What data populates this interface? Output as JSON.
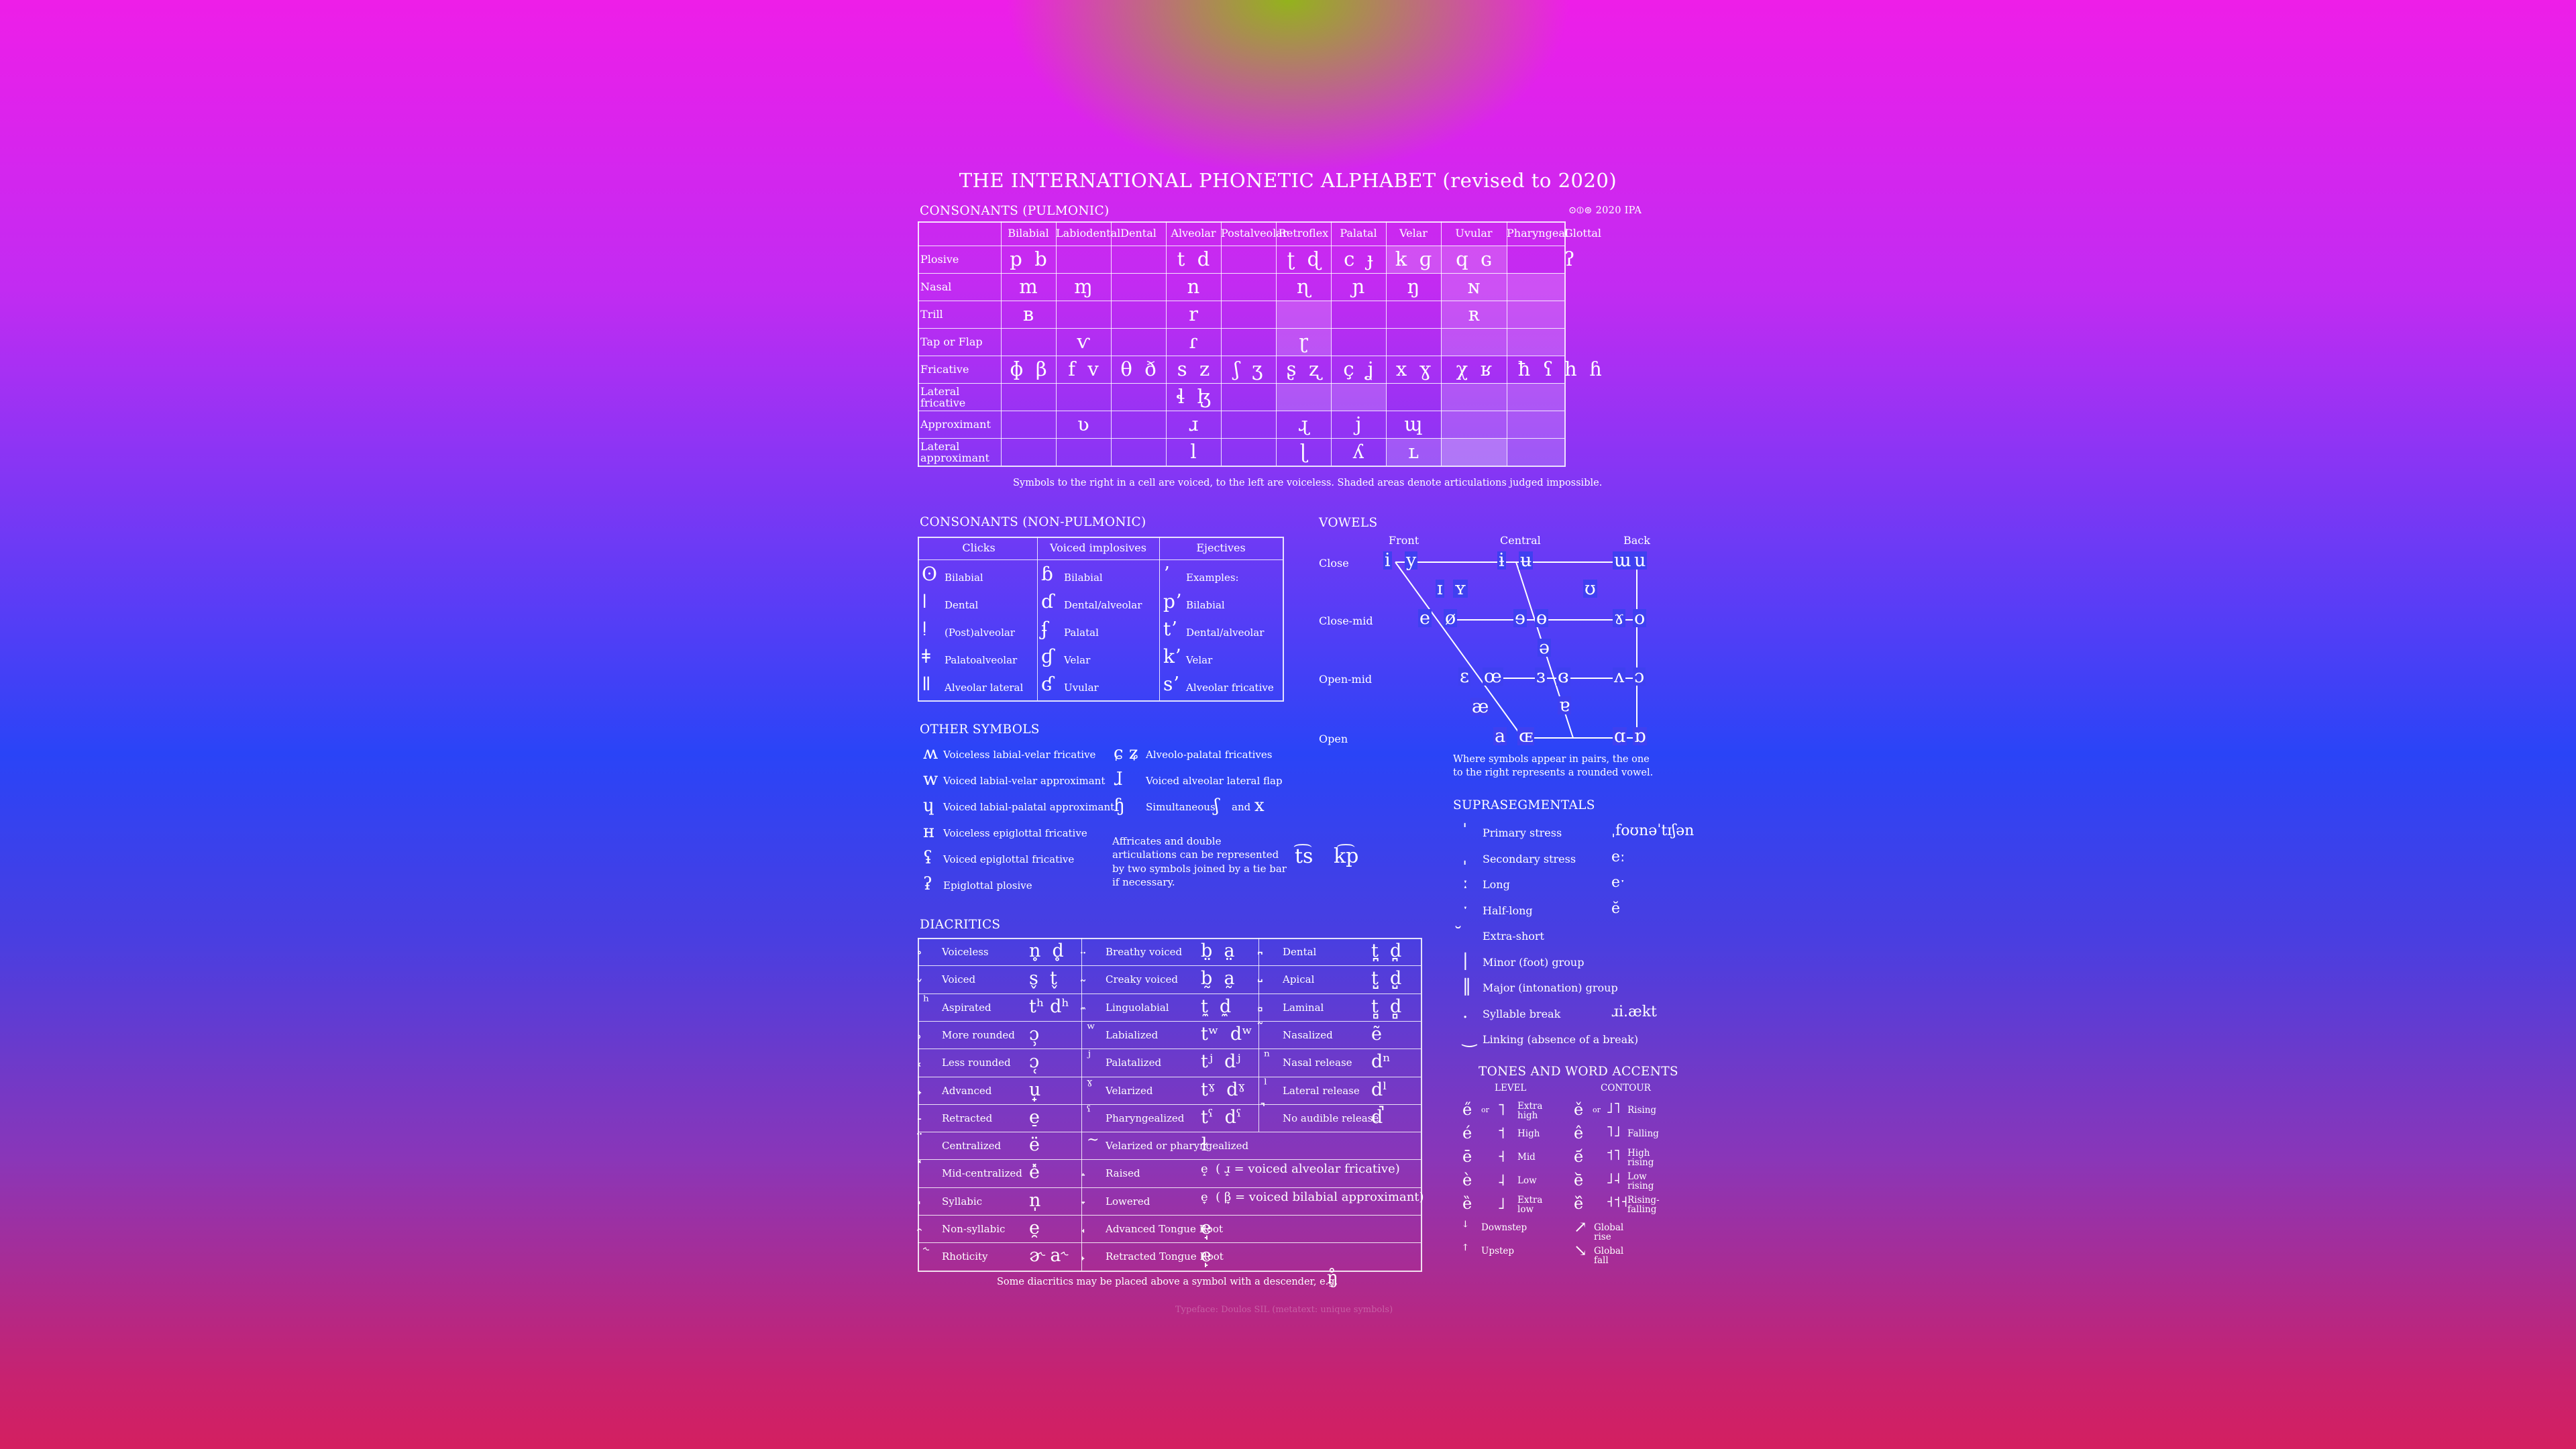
{
  "title": "THE INTERNATIONAL PHONETIC ALPHABET (revised to 2020)",
  "pulmonic": {
    "heading": "CONSONANTS (PULMONIC)",
    "copyright": "⊙⦶⊚ 2020 IPA",
    "columns": [
      "Bilabial",
      "Labiodental",
      "Dental",
      "Alveolar",
      "Postalveolar",
      "Retroflex",
      "Palatal",
      "Velar",
      "Uvular",
      "Pharyngeal",
      "Glottal"
    ],
    "rows": [
      {
        "label": "Plosive",
        "cells": [
          "p  b",
          "",
          "",
          "t  d",
          "",
          "ʈ  ɖ",
          "c  ɟ",
          "k  ɡ",
          "q  ɢ",
          "",
          "ʔ"
        ]
      },
      {
        "label": "Nasal",
        "cells": [
          "m",
          "ɱ",
          "",
          "n",
          "",
          "ɳ",
          "ɲ",
          "ŋ",
          "ɴ",
          "",
          ""
        ]
      },
      {
        "label": "Trill",
        "cells": [
          "ʙ",
          "",
          "",
          "r",
          "",
          "",
          "",
          "",
          "ʀ",
          "",
          ""
        ]
      },
      {
        "label": "Tap or Flap",
        "cells": [
          "",
          "ⱱ",
          "",
          "ɾ",
          "",
          "ɽ",
          "",
          "",
          "",
          "",
          ""
        ]
      },
      {
        "label": "Fricative",
        "cells": [
          "ɸ  β",
          "f  v",
          "θ  ð",
          "s  z",
          "ʃ  ʒ",
          "ʂ  ʐ",
          "ç  ʝ",
          "x  ɣ",
          "χ  ʁ",
          "ħ  ʕ",
          "h  ɦ"
        ]
      },
      {
        "label": "Lateral fricative",
        "cells": [
          "",
          "",
          "",
          "ɬ  ɮ",
          "",
          "",
          "",
          "",
          "",
          "",
          ""
        ]
      },
      {
        "label": "Approximant",
        "cells": [
          "",
          "ʋ",
          "",
          "ɹ",
          "",
          "ɻ",
          "j",
          "ɰ",
          "",
          "",
          ""
        ]
      },
      {
        "label": "Lateral approximant",
        "cells": [
          "",
          "",
          "",
          "l",
          "",
          "ɭ",
          "ʎ",
          "ʟ",
          "",
          "",
          ""
        ]
      }
    ],
    "note": "Symbols to the right in a cell are voiced, to the left are voiceless. Shaded areas denote articulations judged impossible."
  },
  "nonpulmonic": {
    "heading": "CONSONANTS (NON-PULMONIC)",
    "columns": [
      "Clicks",
      "Voiced implosives",
      "Ejectives"
    ],
    "clicks": [
      [
        "ʘ",
        "Bilabial"
      ],
      [
        "ǀ",
        "Dental"
      ],
      [
        "ǃ",
        "(Post)alveolar"
      ],
      [
        "ǂ",
        "Palatoalveolar"
      ],
      [
        "ǁ",
        "Alveolar lateral"
      ]
    ],
    "implosives": [
      [
        "ɓ",
        "Bilabial"
      ],
      [
        "ɗ",
        "Dental/alveolar"
      ],
      [
        "ʄ",
        "Palatal"
      ],
      [
        "ɠ",
        "Velar"
      ],
      [
        "ʛ",
        "Uvular"
      ]
    ],
    "ejectives": [
      [
        "ʼ",
        "Examples:"
      ],
      [
        "pʼ",
        "Bilabial"
      ],
      [
        "tʼ",
        "Dental/alveolar"
      ],
      [
        "kʼ",
        "Velar"
      ],
      [
        "sʼ",
        "Alveolar fricative"
      ]
    ]
  },
  "other": {
    "heading": "OTHER SYMBOLS",
    "left": [
      [
        "ʍ",
        "Voiceless labial-velar fricative"
      ],
      [
        "w",
        "Voiced labial-velar approximant"
      ],
      [
        "ɥ",
        "Voiced labial-palatal approximant"
      ],
      [
        "ʜ",
        "Voiceless epiglottal fricative"
      ],
      [
        "ʢ",
        "Voiced epiglottal fricative"
      ],
      [
        "ʡ",
        "Epiglottal plosive"
      ]
    ],
    "right": [
      [
        "ɕ ʑ",
        "Alveolo-palatal fricatives"
      ],
      [
        "ɺ",
        "Voiced alveolar lateral flap"
      ],
      [
        "ɧ",
        "Simultaneous"
      ]
    ],
    "simul_a": "ʃ",
    "simul_and": "and",
    "simul_b": "x",
    "affricate_note": "Affricates and double articulations can be represented by two symbols joined by a tie bar if necessary.",
    "tie1": "t͡s",
    "tie2": "k͡p"
  },
  "vowels": {
    "heading": "VOWELS",
    "front": "Front",
    "central": "Central",
    "back": "Back",
    "heights": [
      "Close",
      "Close-mid",
      "Open-mid",
      "Open"
    ],
    "symbols": {
      "i": "i",
      "y": "y",
      "ɨ": "ɨ",
      "ʉ": "ʉ",
      "ɯ": "ɯ",
      "u": "u",
      "ɪ": "ɪ",
      "ʏ": "ʏ",
      "ʊ": "ʊ",
      "e": "e",
      "ø": "ø",
      "ɘ": "ɘ",
      "ɵ": "ɵ",
      "ɤ": "ɤ",
      "o": "o",
      "ə": "ə",
      "ɛ": "ɛ",
      "œ": "œ",
      "ɜ": "ɜ",
      "ɞ": "ɞ",
      "ʌ": "ʌ",
      "ɔ": "ɔ",
      "æ": "æ",
      "ɐ": "ɐ",
      "a": "a",
      "ɶ": "ɶ",
      "ɑ": "ɑ",
      "ɒ": "ɒ"
    },
    "note": "Where symbols appear in pairs, the one to the right represents a rounded vowel."
  },
  "supra": {
    "heading": "SUPRASEGMENTALS",
    "items": [
      [
        "ˈ",
        "Primary stress"
      ],
      [
        "ˌ",
        "Secondary stress"
      ],
      [
        "ː",
        "Long"
      ],
      [
        "ˑ",
        "Half-long"
      ],
      [
        "̆",
        "Extra-short"
      ],
      [
        "|",
        "Minor (foot) group"
      ],
      [
        "‖",
        "Major (intonation) group"
      ],
      [
        ".",
        "Syllable break"
      ],
      [
        "‿",
        "Linking (absence of a break)"
      ]
    ],
    "examples": [
      "ˌfoʊnəˈtɪʃən",
      "eː",
      "eˑ",
      "ĕ",
      "",
      "",
      "",
      "ɹi.ækt",
      ""
    ]
  },
  "tones": {
    "heading": "TONES AND WORD ACCENTS",
    "level": "LEVEL",
    "contour": "CONTOUR",
    "level_items": [
      [
        "e̋",
        "or",
        "˥",
        "Extra high"
      ],
      [
        "é",
        "",
        "˦",
        "High"
      ],
      [
        "ē",
        "",
        "˧",
        "Mid"
      ],
      [
        "è",
        "",
        "˨",
        "Low"
      ],
      [
        "ȅ",
        "",
        "˩",
        "Extra low"
      ],
      [
        "ꜜ",
        "",
        "",
        "Downstep"
      ],
      [
        "ꜛ",
        "",
        "",
        "Upstep"
      ]
    ],
    "contour_items": [
      [
        "ě",
        "or",
        "˩˥",
        "Rising"
      ],
      [
        "ê",
        "",
        "˥˩",
        "Falling"
      ],
      [
        "e᷄",
        "",
        "˦˥",
        "High rising"
      ],
      [
        "e᷅",
        "",
        "˩˨",
        "Low rising"
      ],
      [
        "e᷈",
        "",
        "˧˦˧",
        "Rising-falling"
      ],
      [
        "↗",
        "",
        "",
        "Global rise"
      ],
      [
        "↘",
        "",
        "",
        "Global fall"
      ]
    ]
  },
  "diacritics": {
    "heading": "DIACRITICS",
    "col1": [
      [
        "̥",
        "Voiceless",
        "n̥  d̥"
      ],
      [
        "̬",
        "Voiced",
        "s̬  t̬"
      ],
      [
        "ʰ",
        "Aspirated",
        "tʰ dʰ"
      ],
      [
        "̹",
        "More rounded",
        "ɔ̹"
      ],
      [
        "̜",
        "Less rounded",
        "ɔ̜"
      ],
      [
        "̟",
        "Advanced",
        "u̟"
      ],
      [
        "̠",
        "Retracted",
        "e̠"
      ],
      [
        "̈",
        "Centralized",
        "ë"
      ],
      [
        "̽",
        "Mid-centralized",
        "e̽"
      ],
      [
        "̩",
        "Syllabic",
        "n̩"
      ],
      [
        "̯",
        "Non-syllabic",
        "e̯"
      ],
      [
        "˞",
        "Rhoticity",
        "ɚ a˞"
      ]
    ],
    "col2": [
      [
        "̤",
        "Breathy voiced",
        "b̤  a̤"
      ],
      [
        "̰",
        "Creaky voiced",
        "b̰  a̰"
      ],
      [
        "̼",
        "Linguolabial",
        "t̼  d̼"
      ],
      [
        "ʷ",
        "Labialized",
        "tʷ  dʷ"
      ],
      [
        "ʲ",
        "Palatalized",
        "tʲ  dʲ"
      ],
      [
        "ˠ",
        "Velarized",
        "tˠ  dˠ"
      ],
      [
        "ˤ",
        "Pharyngealized",
        "tˤ  dˤ"
      ],
      [
        "~",
        "Velarized or pharyngealized",
        "ɫ"
      ],
      [
        "̝",
        "Raised",
        "e̝  ( ɹ̝ = voiced alveolar fricative)"
      ],
      [
        "̞",
        "Lowered",
        "e̞  ( β̞ = voiced bilabial approximant)"
      ],
      [
        "̘",
        "Advanced Tongue Root",
        "e̘"
      ],
      [
        "̙",
        "Retracted Tongue Root",
        "e̙"
      ]
    ],
    "col3": [
      [
        "̪",
        "Dental",
        "t̪  d̪"
      ],
      [
        "̺",
        "Apical",
        "t̺  d̺"
      ],
      [
        "̻",
        "Laminal",
        "t̻  d̻"
      ],
      [
        "̃",
        "Nasalized",
        "ẽ"
      ],
      [
        "ⁿ",
        "Nasal release",
        "dⁿ"
      ],
      [
        "ˡ",
        "Lateral release",
        "dˡ"
      ],
      [
        "̚",
        "No audible release",
        "d̚"
      ],
      [
        "",
        "",
        ""
      ],
      [
        "",
        "",
        ""
      ],
      [
        "",
        "",
        ""
      ],
      [
        "",
        "",
        ""
      ],
      [
        "",
        "",
        ""
      ]
    ],
    "note": "Some diacritics may be placed above a symbol with a descender, e.g.",
    "note_example": "ŋ̊"
  },
  "footer": "Typeface: Doulos SIL (metatext: unique symbols)"
}
